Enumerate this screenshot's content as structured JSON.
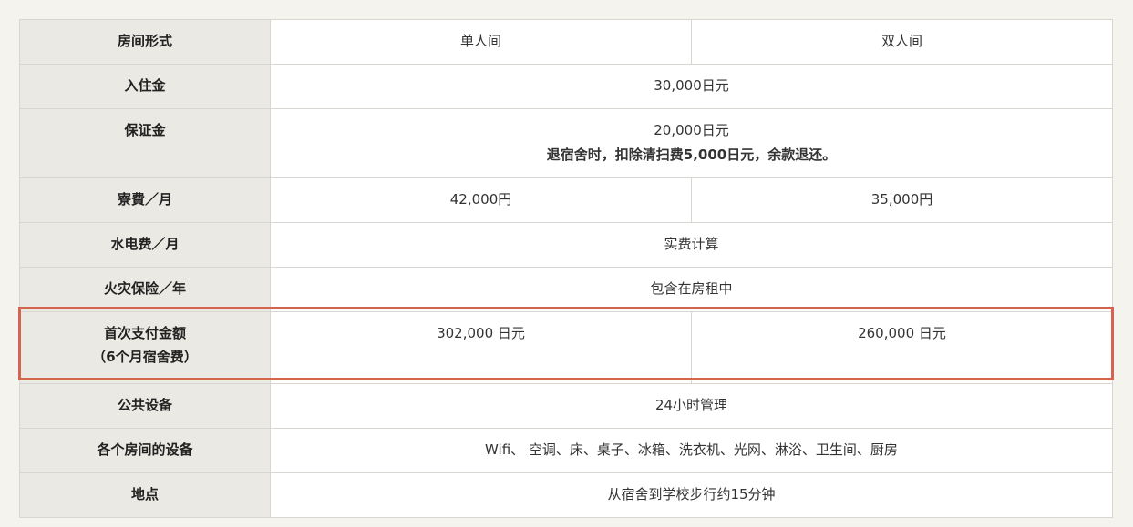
{
  "table": {
    "rows": [
      {
        "label": "房间形式",
        "single": "单人间",
        "double": "双人间"
      },
      {
        "label": "入住金",
        "value": "30,000日元"
      },
      {
        "label": "保证金",
        "value": "20,000日元",
        "note": "退宿舍时，扣除清扫费5,000日元，余款退还。"
      },
      {
        "label": "寮費／月",
        "single": "42,000円",
        "double": "35,000円"
      },
      {
        "label": "水电费／月",
        "value": "实费计算"
      },
      {
        "label": "火灾保险／年",
        "value": "包含在房租中"
      },
      {
        "label": "首次支付金额",
        "label2": "（6个月宿舍费）",
        "single": "302,000 日元",
        "double": "260,000 日元"
      },
      {
        "label": "公共设备",
        "value": "24小时管理"
      },
      {
        "label": "各个房间的设备",
        "value": "Wifi、 空调、床、桌子、冰箱、洗衣机、光网、淋浴、卫生间、厨房"
      },
      {
        "label": "地点",
        "value": "从宿舍到学校步行约15分钟"
      }
    ]
  },
  "colors": {
    "highlight": "#d4634f",
    "header_bg": "#ebe9e3",
    "page_bg": "#f5f3ee"
  }
}
